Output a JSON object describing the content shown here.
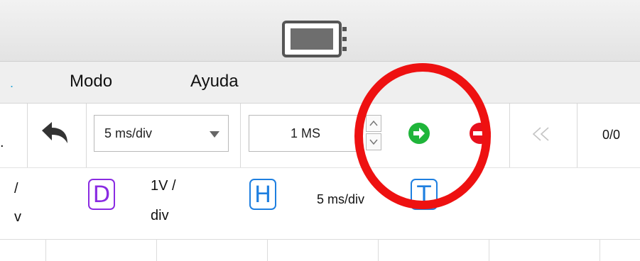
{
  "window": {
    "app_icon": "device-icon"
  },
  "menu": {
    "items": [
      {
        "label": "Modo"
      },
      {
        "label": "Ayuda"
      }
    ]
  },
  "toolbar": {
    "timebase_value": "5  ms/div",
    "memory_value": "1 MS",
    "counter": "0/0",
    "icons": [
      "undo-icon",
      "play-icon",
      "stop-icon",
      "rewind-icon"
    ],
    "colors": {
      "play": "#1fb53a",
      "stop": "#e8101d"
    }
  },
  "channels": {
    "d": {
      "letter": "D",
      "scale_line1": "1V /",
      "scale_line2": "div",
      "color": "#8a2be2"
    },
    "h": {
      "letter": "H",
      "scale": "5 ms/div",
      "color": "#1e7fe0"
    },
    "t": {
      "letter": "T",
      "color": "#1e7fe0"
    },
    "left_partial_line1": "/",
    "left_partial_line2": "v"
  },
  "annotation": {
    "color": "#ee1111",
    "shape": "circle"
  }
}
